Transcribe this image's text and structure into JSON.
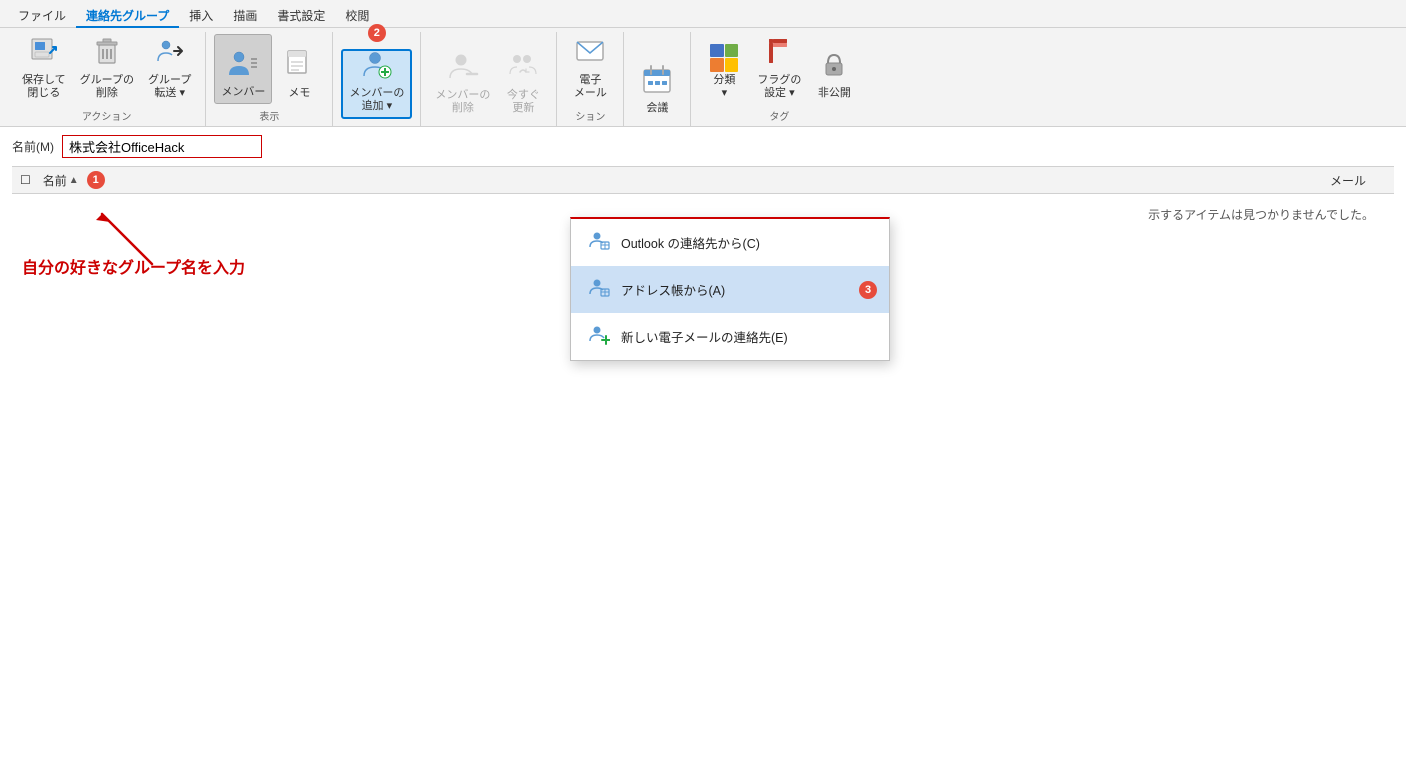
{
  "menuBar": {
    "items": [
      {
        "label": "ファイル",
        "active": false
      },
      {
        "label": "連絡先グループ",
        "active": true
      },
      {
        "label": "挿入",
        "active": false
      },
      {
        "label": "描画",
        "active": false
      },
      {
        "label": "書式設定",
        "active": false
      },
      {
        "label": "校閲",
        "active": false
      }
    ]
  },
  "ribbon": {
    "groups": [
      {
        "label": "アクション",
        "buttons": [
          {
            "id": "save-close",
            "label": "保存して\n閉じる",
            "icon": "💾",
            "type": "large"
          },
          {
            "id": "delete-group",
            "label": "グループの\n削除",
            "icon": "🗑️",
            "type": "large"
          },
          {
            "id": "forward-group",
            "label": "グループ\n転送▾",
            "icon": "👤→",
            "type": "large"
          }
        ]
      },
      {
        "label": "表示",
        "buttons": [
          {
            "id": "member",
            "label": "メンバー",
            "icon": "member",
            "type": "large",
            "highlighted": true
          },
          {
            "id": "memo",
            "label": "メモ",
            "icon": "memo",
            "type": "large"
          }
        ]
      },
      {
        "label": "メンバーの追加",
        "step": "2",
        "buttons": [
          {
            "id": "add-member",
            "label": "メンバーの\n追加▾",
            "icon": "add-member",
            "type": "large",
            "activeMenu": true
          }
        ]
      },
      {
        "label": "",
        "buttons": [
          {
            "id": "remove-member",
            "label": "メンバーの\n削除",
            "icon": "remove-member",
            "type": "large",
            "disabled": true
          },
          {
            "id": "update-now",
            "label": "今すぐ\n更新",
            "icon": "update",
            "type": "large",
            "disabled": true
          }
        ]
      },
      {
        "label": "ション",
        "buttons": [
          {
            "id": "email",
            "label": "電子\nメール",
            "icon": "email",
            "type": "large"
          }
        ]
      },
      {
        "label": "",
        "buttons": [
          {
            "id": "meeting",
            "label": "会議",
            "icon": "meeting",
            "type": "large"
          }
        ]
      },
      {
        "label": "タグ",
        "buttons": [
          {
            "id": "classify",
            "label": "分類\n▾",
            "icon": "classify",
            "type": "large"
          },
          {
            "id": "flag",
            "label": "フラグの\n設定▾",
            "icon": "flag",
            "type": "large"
          },
          {
            "id": "private",
            "label": "非公開",
            "icon": "lock",
            "type": "large"
          }
        ]
      }
    ]
  },
  "content": {
    "nameLabel": "名前(M)",
    "nameValue": "株式会社OfficeHack",
    "columnHeaders": [
      {
        "label": "名前",
        "sortIndicator": "▲",
        "active": true
      },
      {
        "label": "メール",
        "active": false
      }
    ],
    "emptyMessage": "示するアイテムは見つかりませんでした。",
    "annotation": {
      "step1Label": "1",
      "arrowText": "自分の好きなグループ名を入力"
    }
  },
  "dropdownMenu": {
    "step": "3",
    "items": [
      {
        "id": "from-outlook",
        "label": "Outlook の連絡先から(C)",
        "icon": "contacts"
      },
      {
        "id": "from-addressbook",
        "label": "アドレス帳から(A)",
        "icon": "addressbook",
        "selected": true,
        "hasStep": true
      },
      {
        "id": "new-email-contact",
        "label": "新しい電子メールの連絡先(E)",
        "icon": "new-contact"
      }
    ]
  }
}
